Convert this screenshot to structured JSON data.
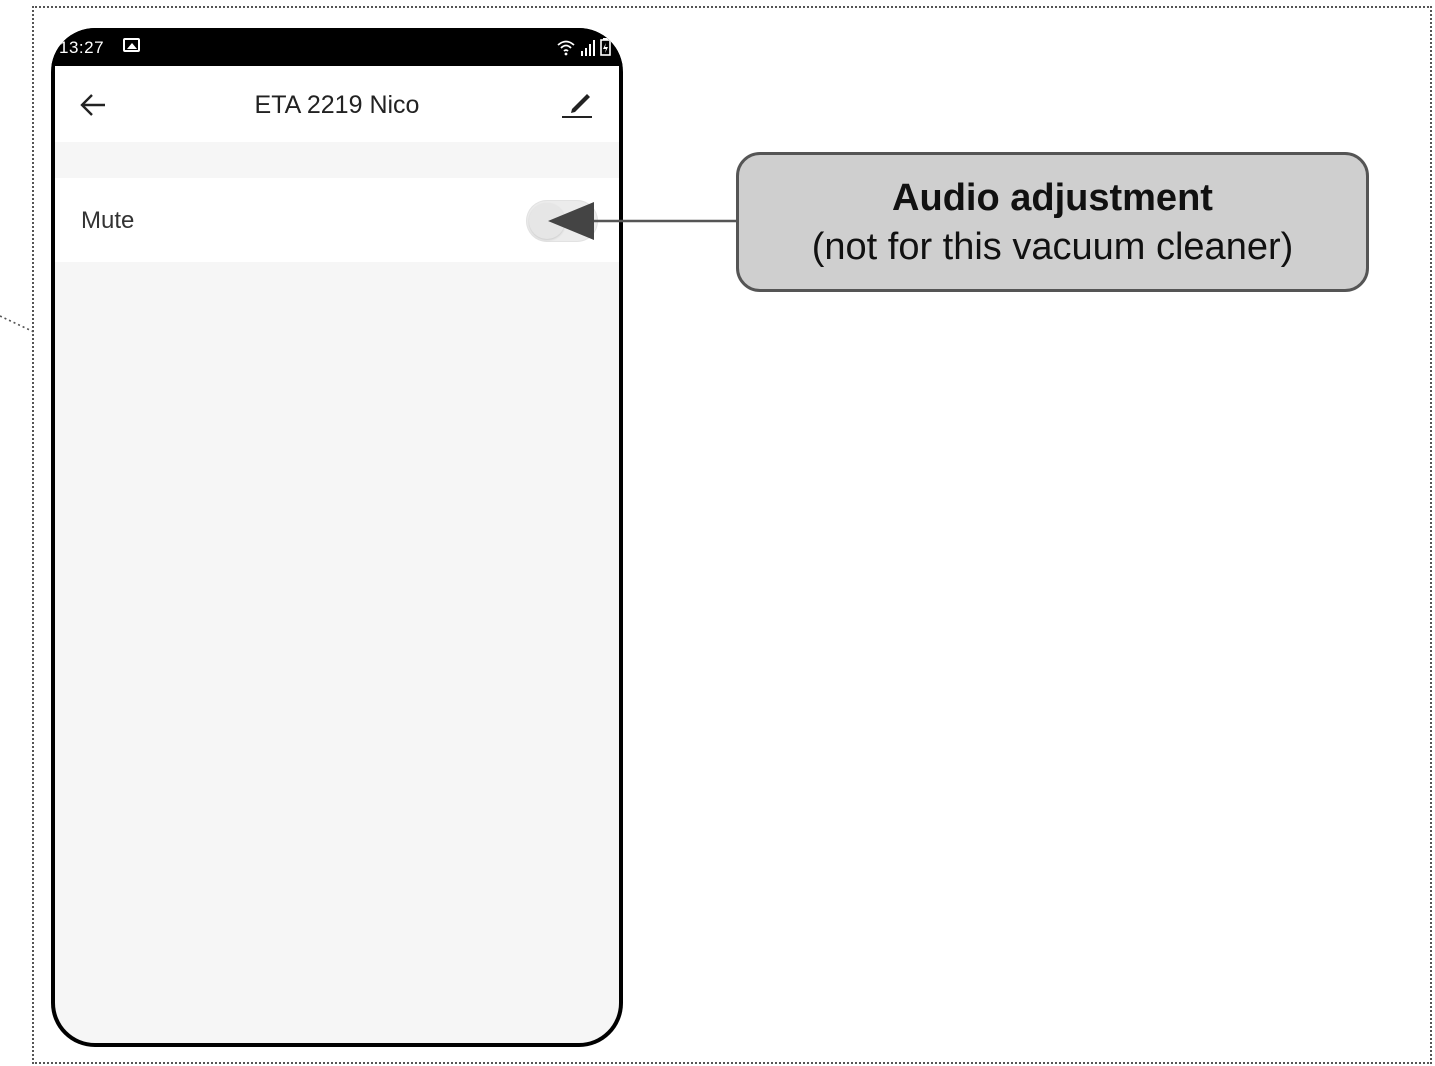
{
  "status_bar": {
    "time": "13:27",
    "left_icons": [
      "image-icon"
    ],
    "right_icons": [
      "wifi-icon",
      "signal-icon",
      "battery-icon"
    ]
  },
  "header": {
    "title": "ETA 2219 Nico",
    "back_icon": "back-arrow-icon",
    "edit_icon": "edit-pencil-icon"
  },
  "settings": {
    "mute_label": "Mute",
    "mute_on": false
  },
  "callout": {
    "title": "Audio adjustment",
    "subtitle": "(not for this vacuum cleaner)"
  },
  "colors": {
    "callout_bg": "#cfcfcf",
    "callout_border": "#555555",
    "phone_frame": "#000000",
    "screen_bg": "#f6f6f6"
  }
}
